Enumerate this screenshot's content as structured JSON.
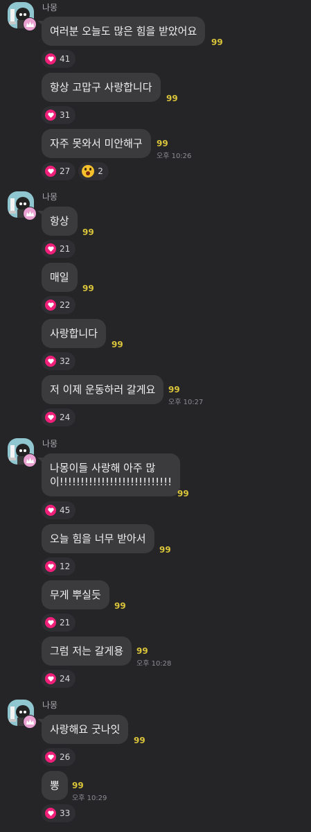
{
  "groups": [
    {
      "sender": "나몽",
      "messages": [
        {
          "text": "여러분 오늘도 많은 힘을 받았어요",
          "unread": "99",
          "reactions": [
            {
              "icon": "heart",
              "count": "41"
            }
          ]
        },
        {
          "text": "항상 고맙구 사랑합니다",
          "unread": "99",
          "reactions": [
            {
              "icon": "heart",
              "count": "31"
            }
          ]
        },
        {
          "text": "자주 못와서 미안해구",
          "unread": "99",
          "time": "오후 10:26",
          "reactions": [
            {
              "icon": "heart",
              "count": "27"
            },
            {
              "icon": "surprised",
              "count": "2"
            }
          ]
        }
      ]
    },
    {
      "sender": "나몽",
      "messages": [
        {
          "text": "항상",
          "unread": "99",
          "reactions": [
            {
              "icon": "heart",
              "count": "21"
            }
          ]
        },
        {
          "text": "매일",
          "unread": "99",
          "reactions": [
            {
              "icon": "heart",
              "count": "22"
            }
          ]
        },
        {
          "text": "사랑합니다",
          "unread": "99",
          "reactions": [
            {
              "icon": "heart",
              "count": "32"
            }
          ]
        },
        {
          "text": "저 이제 운동하러 갈게요",
          "unread": "99",
          "time": "오후 10:27",
          "reactions": [
            {
              "icon": "heart",
              "count": "24"
            }
          ]
        }
      ]
    },
    {
      "sender": "나몽",
      "messages": [
        {
          "text": "나몽이들 사랑해 아주 많",
          "text2": "이!!!!!!!!!!!!!!!!!!!!!!!!!!!",
          "unread": "99",
          "reactions": [
            {
              "icon": "heart",
              "count": "45"
            }
          ]
        },
        {
          "text": "오늘 힘을 너무 받아서",
          "unread": "99",
          "reactions": [
            {
              "icon": "heart",
              "count": "12"
            }
          ]
        },
        {
          "text": "무게 뿌실듯",
          "unread": "99",
          "reactions": [
            {
              "icon": "heart",
              "count": "21"
            }
          ]
        },
        {
          "text": "그럼 저는 갈게용",
          "unread": "99",
          "time": "오후 10:28",
          "reactions": [
            {
              "icon": "heart",
              "count": "24"
            }
          ]
        }
      ]
    },
    {
      "sender": "나몽",
      "messages": [
        {
          "text": "사랑해요 굿나잇",
          "unread": "99",
          "reactions": [
            {
              "icon": "heart",
              "count": "26"
            }
          ]
        },
        {
          "text": "뽕",
          "unread": "99",
          "time": "오후 10:29",
          "reactions": [
            {
              "icon": "heart",
              "count": "33"
            }
          ]
        }
      ]
    }
  ]
}
